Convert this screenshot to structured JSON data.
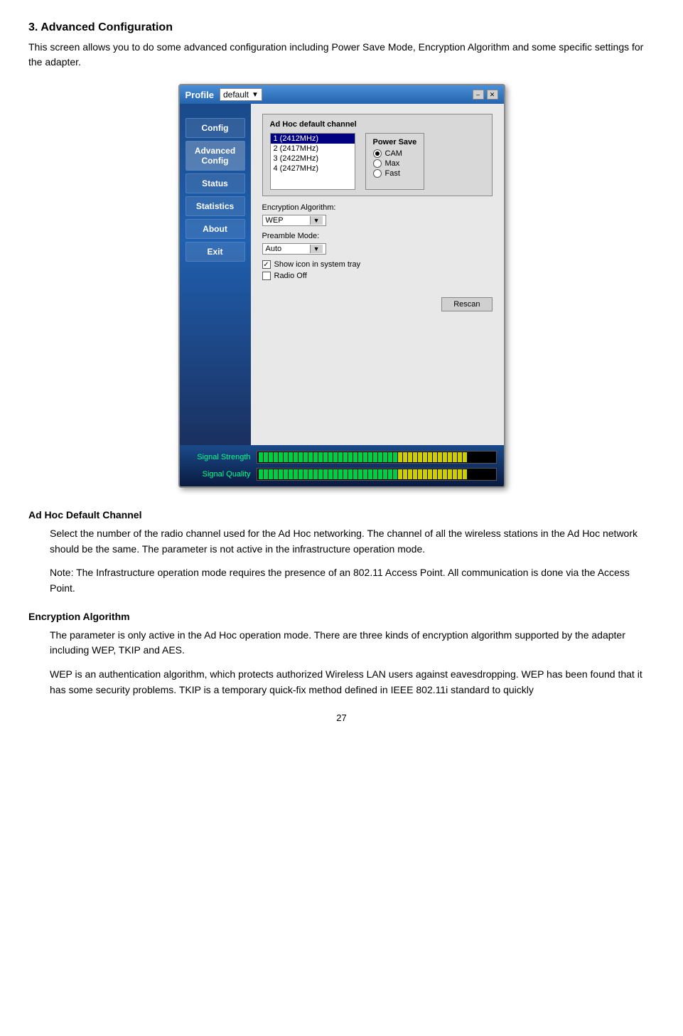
{
  "heading": "3. Advanced Configuration",
  "intro": "This screen allows you to do some advanced configuration including Power Save Mode, Encryption Algorithm and some specific settings for the adapter.",
  "app_window": {
    "title_bar": {
      "label": "Profile",
      "profile_value": "default",
      "controls": [
        "–",
        "✕"
      ]
    },
    "sidebar": {
      "items": [
        {
          "label": "Config",
          "active": false
        },
        {
          "label": "Advanced Config",
          "active": true
        },
        {
          "label": "Status",
          "active": false
        },
        {
          "label": "Statistics",
          "active": false
        },
        {
          "label": "About",
          "active": false
        },
        {
          "label": "Exit",
          "active": false
        }
      ]
    },
    "main": {
      "adhoc_label": "Ad Hoc default channel",
      "channels": [
        {
          "value": "1  (2412MHz)",
          "selected": true
        },
        {
          "value": "2  (2417MHz)",
          "selected": false
        },
        {
          "value": "3  (2422MHz)",
          "selected": false
        },
        {
          "value": "4  (2427MHz)",
          "selected": false
        }
      ],
      "power_save": {
        "label": "Power Save",
        "options": [
          {
            "label": "CAM",
            "selected": true
          },
          {
            "label": "Max",
            "selected": false
          },
          {
            "label": "Fast",
            "selected": false
          }
        ]
      },
      "encryption_label": "Encryption Algorithm:",
      "encryption_value": "WEP",
      "preamble_label": "Preamble Mode:",
      "preamble_value": "Auto",
      "checkboxes": [
        {
          "label": "Show icon in system tray",
          "checked": true
        },
        {
          "label": "Radio Off",
          "checked": false
        }
      ],
      "rescan_btn": "Rescan"
    },
    "signal": {
      "rows": [
        {
          "label": "Signal Strength",
          "fill": 42
        },
        {
          "label": "Signal Quality",
          "fill": 42
        }
      ]
    }
  },
  "sections": [
    {
      "heading": "Ad Hoc Default Channel",
      "paragraphs": [
        "Select the number of the radio channel used for the Ad Hoc networking. The channel of all the wireless stations in the Ad Hoc network should be the same. The parameter is not active in the infrastructure operation mode.",
        "Note: The Infrastructure operation mode requires the presence of an 802.11 Access Point. All communication is done via the Access Point."
      ]
    },
    {
      "heading": "Encryption Algorithm",
      "paragraphs": [
        "The parameter is only active in the Ad Hoc operation mode. There are three kinds of encryption algorithm supported by the adapter including WEP, TKIP and AES.",
        "WEP is an authentication algorithm, which protects authorized Wireless LAN users against eavesdropping. WEP has been found that it has some security problems. TKIP is a temporary quick-fix method defined in IEEE 802.11i standard to quickly"
      ]
    }
  ],
  "page_number": "27"
}
